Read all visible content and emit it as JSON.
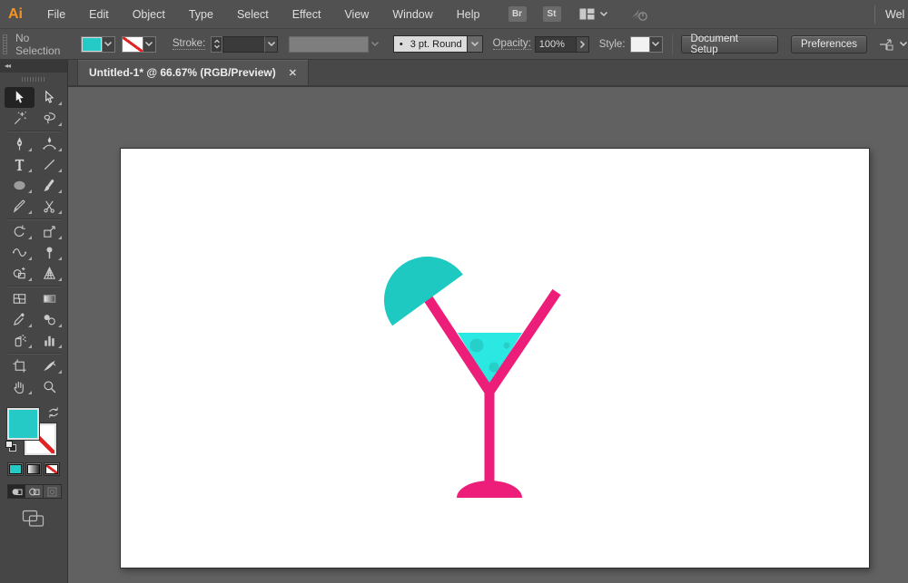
{
  "menu_bar": {
    "logo": "Ai",
    "items": [
      "File",
      "Edit",
      "Object",
      "Type",
      "Select",
      "Effect",
      "View",
      "Window",
      "Help"
    ],
    "bridge_button": "Br",
    "stock_button": "St",
    "workspace_switcher_icon": "workspace-layout-icon",
    "cc_icon": "creative-cloud-sync-icon",
    "workspace_label": "Wel"
  },
  "control_bar": {
    "selection_status": "No Selection",
    "fill_swatch_icon": "fill-color-swatch",
    "stroke_swatch_icon": "stroke-color-none-swatch",
    "stroke_label": "Stroke:",
    "brush_bullet": "•",
    "brush_preset": "3 pt. Round",
    "opacity_label": "Opacity:",
    "opacity_value": "100%",
    "style_label": "Style:",
    "document_setup": "Document Setup",
    "preferences": "Preferences",
    "isolate_icon": "isolate-selected-object-icon"
  },
  "tab": {
    "title": "Untitled-1* @ 66.67% (RGB/Preview)",
    "close_icon": "✕"
  },
  "dock": {
    "collapse_icon": "◂◂"
  },
  "toolbar": {
    "tools": [
      "selection",
      "direct-selection",
      "magic-wand",
      "lasso",
      "pen",
      "curvature",
      "type",
      "line-segment",
      "ellipse",
      "paintbrush",
      "pencil",
      "scissors",
      "rotate",
      "free-transform",
      "width",
      "puppet-warp",
      "shape-builder",
      "perspective-grid",
      "mesh",
      "gradient",
      "eyedropper",
      "blend",
      "symbol-sprayer",
      "column-graph",
      "artboard",
      "slice",
      "hand",
      "zoom"
    ],
    "controls": [
      "fill-color",
      "stroke-color",
      "swap-fill-stroke",
      "default-fill-stroke",
      "color-mode",
      "gradient-mode",
      "none-mode",
      "draw-normal",
      "draw-behind",
      "draw-inside",
      "change-screen-mode"
    ]
  },
  "artwork": {
    "pink": "#EC1E79",
    "liquid": "#2BE8E2",
    "umbrella": "#1EC9C1",
    "bubbles": "#26CFC7"
  },
  "ui_colors": {
    "fill_swatch": "#25C9C6",
    "none_slash_red": "#E02424",
    "logo_orange": "#F7931E",
    "pasteboard_gray": "#616161"
  }
}
